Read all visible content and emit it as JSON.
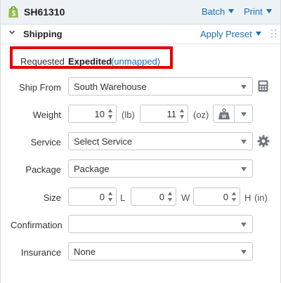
{
  "header": {
    "store_icon": "shopify-bag-icon",
    "order_id": "SH61310",
    "batch_label": "Batch",
    "print_label": "Print"
  },
  "section": {
    "title": "Shipping",
    "apply_preset_label": "Apply Preset",
    "collapse_icon": "chevron-down-icon",
    "drag_icon": "drag-handle-icon"
  },
  "requested": {
    "label": "Requested",
    "value": "Expedited",
    "mapping_status": "(unmapped)",
    "highlight_color": "#e60000"
  },
  "ship_from": {
    "label": "Ship From",
    "value": "South Warehouse",
    "side_icon": "calculator-icon"
  },
  "weight": {
    "label": "Weight",
    "lb_value": "10",
    "lb_unit": "(lb)",
    "oz_value": "11",
    "oz_unit": "(oz)",
    "scale_icon": "scale-weight-icon",
    "scale_letter": "W"
  },
  "service": {
    "label": "Service",
    "value": "Select Service",
    "side_icon": "gear-icon"
  },
  "package": {
    "label": "Package",
    "value": "Package"
  },
  "size": {
    "label": "Size",
    "length": "0",
    "length_unit": "L",
    "width": "0",
    "width_unit": "W",
    "height": "0",
    "height_unit": "H",
    "units": "(in)"
  },
  "confirmation": {
    "label": "Confirmation",
    "value": ""
  },
  "insurance": {
    "label": "Insurance",
    "value": "None"
  },
  "colors": {
    "link": "#1a6fb5",
    "header_bg": "#edf2f6",
    "shopify_green": "#95bf47"
  }
}
